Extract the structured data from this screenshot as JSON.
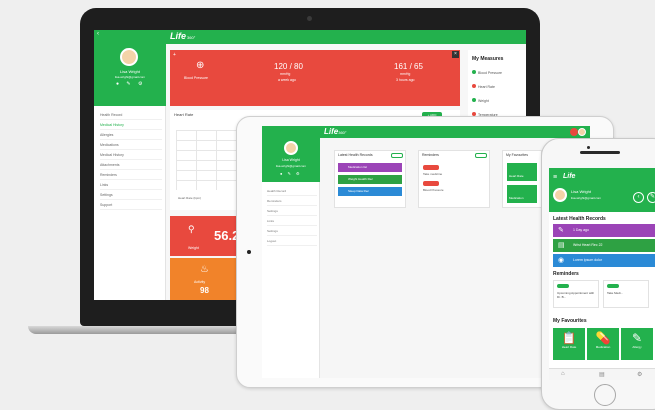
{
  "brand": {
    "logo_text": "Life",
    "logo_suffix": "360°",
    "accent": "#23b14d",
    "red": "#e8493e",
    "orange": "#f1832a"
  },
  "laptop": {
    "profile": {
      "name": "Lisa Wright",
      "subtitle": "lisa.wright@gmail.com"
    },
    "menu": [
      "Health Record",
      "Medical History",
      "Allergies",
      "Medications",
      "Medical History",
      "Attachments",
      "Reminders",
      "Links",
      "Settings",
      "Support"
    ],
    "blood_pressure": {
      "label": "Blood Pressure",
      "value1": "120 / 80",
      "unit1": "mmHg",
      "note1": "a week ago",
      "value2": "161 / 65",
      "unit2": "mmHg",
      "note2": "3 hours ago"
    },
    "measures": {
      "title": "My Measures",
      "items": [
        "Blood Pressure",
        "Heart Rate",
        "Weight",
        "Temperature"
      ]
    },
    "heart_rate": {
      "title": "Heart Rate",
      "add_label": "+ ADD",
      "legend": "Heart Rate (bpm)"
    },
    "weight_tile": {
      "value": "56.2",
      "label": "Weight"
    },
    "activity_tile": {
      "value": "98",
      "label": "Activity"
    }
  },
  "tablet": {
    "profile": {
      "name": "Lisa Wright",
      "subtitle": "lisa.wright@gmail.com"
    },
    "menu": [
      "Health Record",
      "Reminders",
      "Settings",
      "Links",
      "Settings",
      "Logout"
    ],
    "cards": {
      "records": {
        "title": "Latest Health Records",
        "items": [
          "Medication list",
          "Weight Health Rec",
          "Sleep Data Rec"
        ]
      },
      "reminders": {
        "title": "Reminders",
        "items": [
          "Take medicine",
          "Blood Pressure"
        ]
      },
      "favourites": {
        "title": "My Favourites",
        "items": [
          "Heart Rate",
          "Medication"
        ]
      }
    }
  },
  "phone": {
    "profile": {
      "name": "Lisa Wright",
      "subtitle": "lisa.wright@gmail.com"
    },
    "latest_title": "Latest Health Records",
    "records": [
      {
        "label": "1 Day ago",
        "color": "#9b44b7"
      },
      {
        "label": "Wrist Heart Rec 22",
        "color": "#2ea143"
      },
      {
        "label": "Lorem ipsum dolor",
        "color": "#2b8ad6"
      }
    ],
    "reminders_title": "Reminders",
    "reminders": [
      "Upcoming Appointment with Dr. B...",
      "Take Medi..."
    ],
    "favourites_title": "My Favourites",
    "favourites": [
      {
        "icon": "📋",
        "label": "Heart Rate"
      },
      {
        "icon": "💊",
        "label": "Medication"
      },
      {
        "icon": "✎",
        "label": "Allergy"
      }
    ]
  }
}
